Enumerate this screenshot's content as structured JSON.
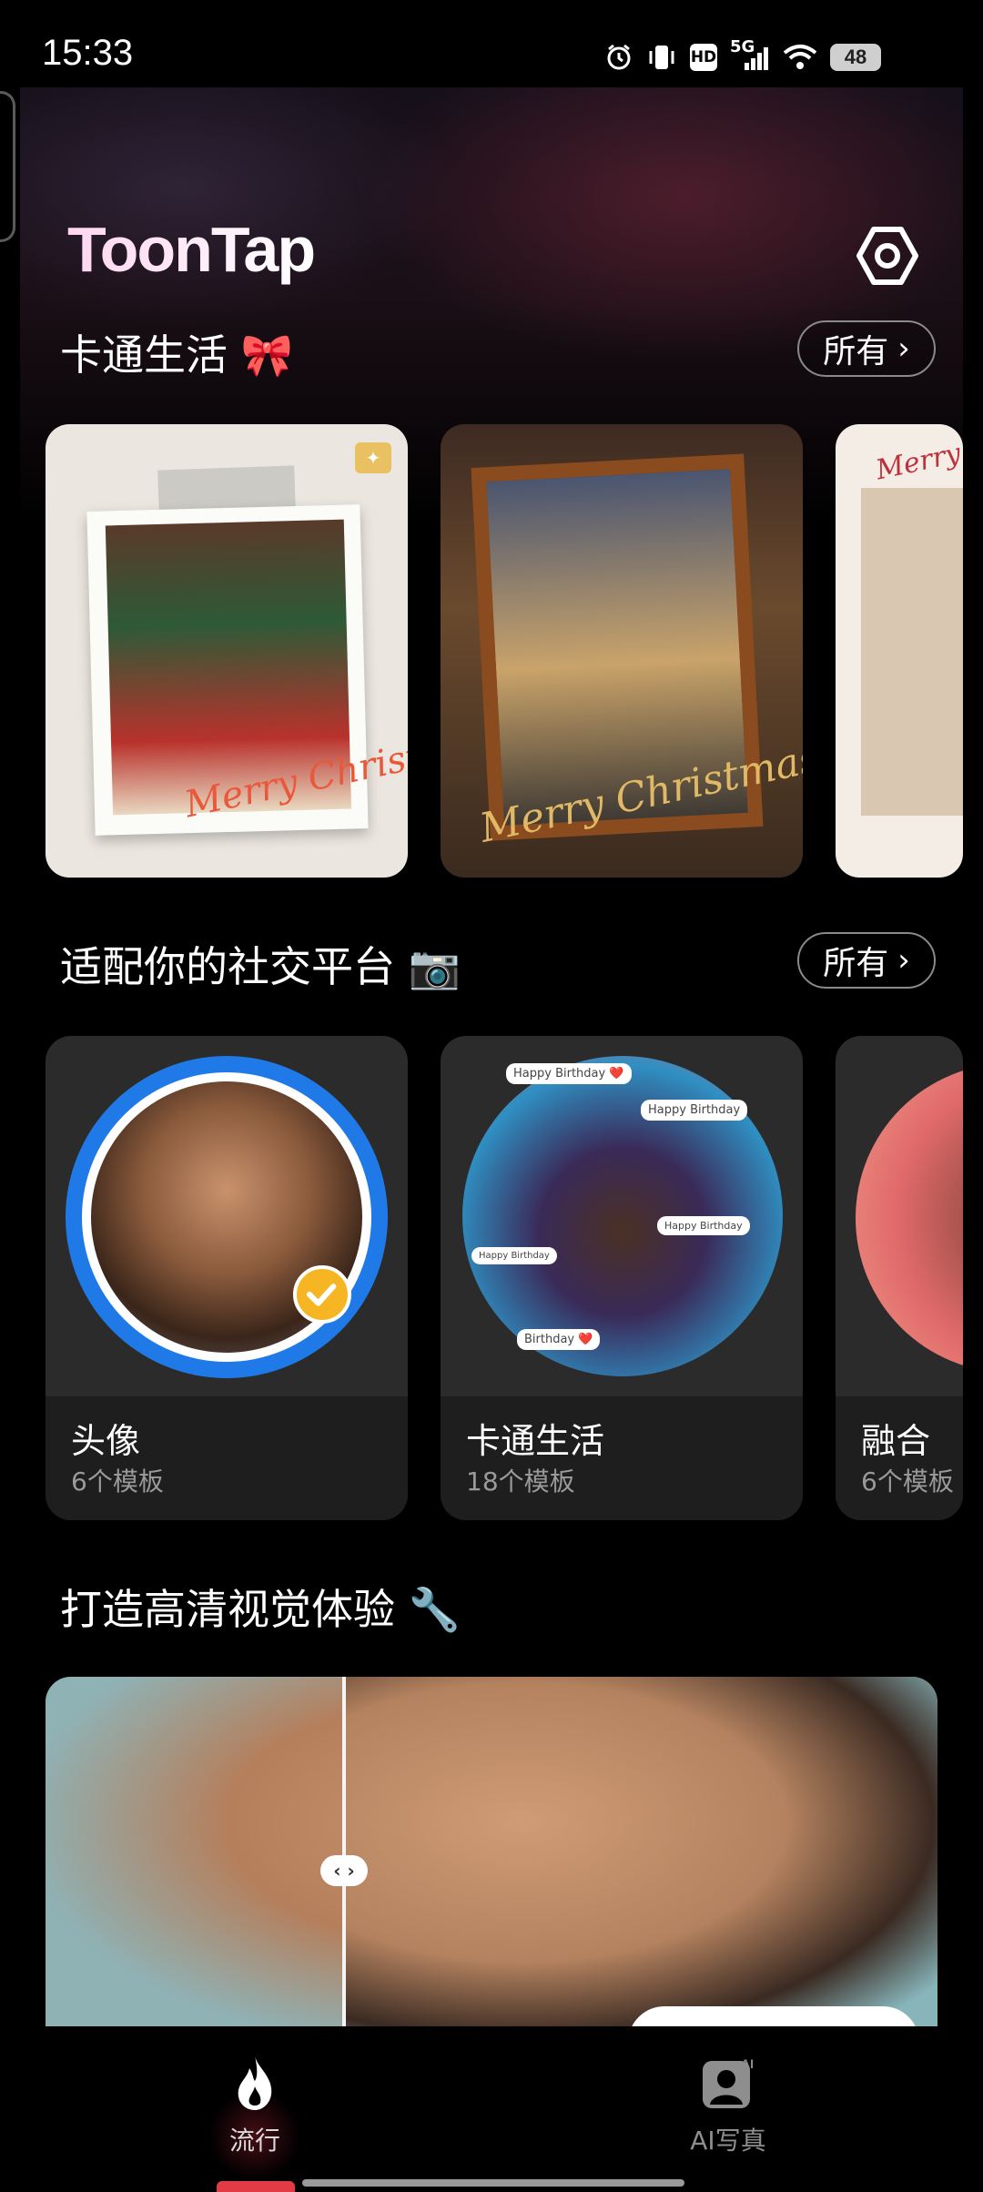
{
  "status_bar": {
    "time": "15:33",
    "hd": "HD",
    "network": "5G",
    "battery": "48",
    "icons": [
      "alarm-icon",
      "vibrate-icon",
      "hd-icon",
      "signal-icon",
      "wifi-icon",
      "battery-icon"
    ]
  },
  "header": {
    "logo": "ToonTap",
    "settings_icon": "settings-hexagon-icon"
  },
  "sections": {
    "cartoon_life": {
      "title": "卡通生活 🎀",
      "more_label": "所有",
      "items": [
        {
          "caption": "Merry Christmas"
        },
        {
          "caption": "Merry Christmas"
        },
        {
          "caption": "Merry"
        }
      ]
    },
    "social": {
      "title": "适配你的社交平台 📷",
      "more_label": "所有",
      "cards": [
        {
          "name": "头像",
          "count": "6个模板"
        },
        {
          "name": "卡通生活",
          "count": "18个模板"
        },
        {
          "name": "融合",
          "count": "6个模板"
        }
      ],
      "bubbles": [
        "Happy Birthday ❤️",
        "Happy Birthday",
        "Happy Birthday",
        "Happy Birthday",
        "Birthday ❤️"
      ]
    },
    "hd": {
      "title": "打造高清视觉体验 🔧",
      "handle": "‹ ›"
    }
  },
  "bottom_nav": {
    "items": [
      {
        "label": "流行",
        "icon": "flame-icon",
        "active": true
      },
      {
        "label": "AI写真",
        "icon": "ai-portrait-icon",
        "active": false
      }
    ]
  },
  "colors": {
    "accent_blue": "#1f7ae8",
    "check_yellow": "#f6b624",
    "nav_active_red": "#e23b46"
  }
}
